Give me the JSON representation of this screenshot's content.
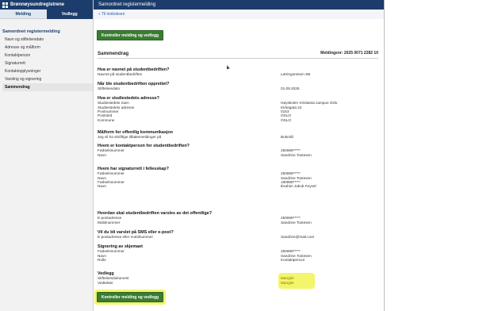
{
  "app": {
    "brand": "Brønnøysundregistrene",
    "tabs": [
      "Melding",
      "Vedlegg"
    ]
  },
  "header": {
    "title": "Samordnet registermelding",
    "back_link": "« Til innboksen"
  },
  "sidebar": {
    "section_title": "Samordnet registermelding",
    "items": [
      "Navn og stiftelsesdato",
      "Adresse og målform",
      "Kontaktperson",
      "Signaturrett",
      "Kontaktopplysninger",
      "Varsling og signering",
      "Sammendrag"
    ]
  },
  "buttons": {
    "check_top": "Kontroller melding og vedlegg",
    "check_bottom": "Kontroller melding og vedlegg"
  },
  "summary": {
    "title": "Sammendrag",
    "ref": "Meldingsnr: 2025 0071 2282 10"
  },
  "sections": [
    {
      "q": "Hva er navnet på studentbedriften?",
      "rows": [
        [
          "Navnet på studentbedriften",
          "Læringsreisen SB"
        ]
      ]
    },
    {
      "q": "Når ble studentbedriften opprettet?",
      "rows": [
        [
          "Stiftelsesdato",
          "01.09.2025"
        ]
      ]
    },
    {
      "q": "Hva er studiestedets adresse?",
      "rows": [
        [
          "Studiestedets navn",
          "Høyskolen Kristiania campus Oslo"
        ],
        [
          "Studiestedets adresse",
          "Kirkegata 24"
        ],
        [
          "Postnummer",
          "0153"
        ],
        [
          "Poststed",
          "OSLO"
        ],
        [
          "Kommune",
          "OSLO"
        ]
      ]
    },
    {
      "q": "Målform for offentlig kommunikasjon",
      "rows": [
        [
          "Jeg vil ha skriftlige tilbakemeldinger på",
          "Bokmål"
        ]
      ]
    },
    {
      "q": "Hvem er kontaktperson for studentbedriften?",
      "rows": [
        [
          "Fødselsnummer",
          "250699*****"
        ],
        [
          "Navn",
          "Sandrine Tostesen"
        ]
      ]
    },
    {
      "q": "Hvem har signaturrett i fellesskap?",
      "rows": [
        [
          "Fødselsnummer",
          "250699*****"
        ],
        [
          "Navn",
          "Sandrine Tostesen"
        ],
        [
          "",
          ""
        ],
        [
          "Fødselsnummer",
          "180899*****"
        ],
        [
          "Navn",
          "Ibrahim Jakub Feysel"
        ]
      ]
    },
    {
      "q": "Hvordan skal studentbedriften varsles av det offentlige?",
      "rows": [
        [
          "E-postadresse",
          "250699*****"
        ],
        [
          "Mobilnummer",
          "Sandrine Tostesen"
        ]
      ]
    },
    {
      "q": "Vil du bli varslet på SMS eller e-post?",
      "rows": [
        [
          "E-postadresse eller mobilnummer",
          "Sandrine@mail.com"
        ]
      ]
    },
    {
      "q": "Signering av skjemaet",
      "rows": [
        [
          "Fødselsnummer",
          "250699*****"
        ],
        [
          "Navn",
          "Sandrine Tostesen"
        ],
        [
          "Rolle",
          "Kontaktperson"
        ]
      ]
    },
    {
      "q": "Vedlegg",
      "rows": [
        [
          "Stiftelsesdokument",
          "Mangler"
        ],
        [
          "Vedtekter",
          "Mangler"
        ]
      ]
    }
  ],
  "colors": {
    "brand_navy": "#1c3d6b",
    "button_green": "#3a7d32",
    "highlight_yellow": "#f3f56a"
  }
}
